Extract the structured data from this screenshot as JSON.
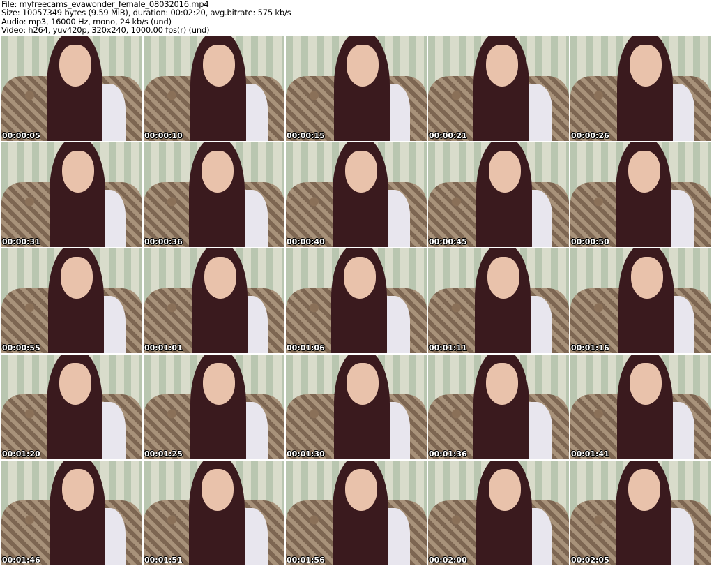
{
  "header": {
    "file": "File: myfreecams_evawonder_female_08032016.mp4",
    "size": "Size: 10057349 bytes (9.59 MiB), duration: 00:02:20, avg.bitrate: 575 kb/s",
    "audio": "Audio: mp3, 16000 Hz, mono, 24 kb/s (und)",
    "video": "Video: h264, yuv420p, 320x240, 1000.00 fps(r) (und)"
  },
  "frames": [
    "00:00:05",
    "00:00:10",
    "00:00:15",
    "00:00:21",
    "00:00:26",
    "00:00:31",
    "00:00:36",
    "00:00:40",
    "00:00:45",
    "00:00:50",
    "00:00:55",
    "00:01:01",
    "00:01:06",
    "00:01:11",
    "00:01:16",
    "00:01:20",
    "00:01:25",
    "00:01:30",
    "00:01:36",
    "00:01:41",
    "00:01:46",
    "00:01:51",
    "00:01:56",
    "00:02:00",
    "00:02:05"
  ]
}
